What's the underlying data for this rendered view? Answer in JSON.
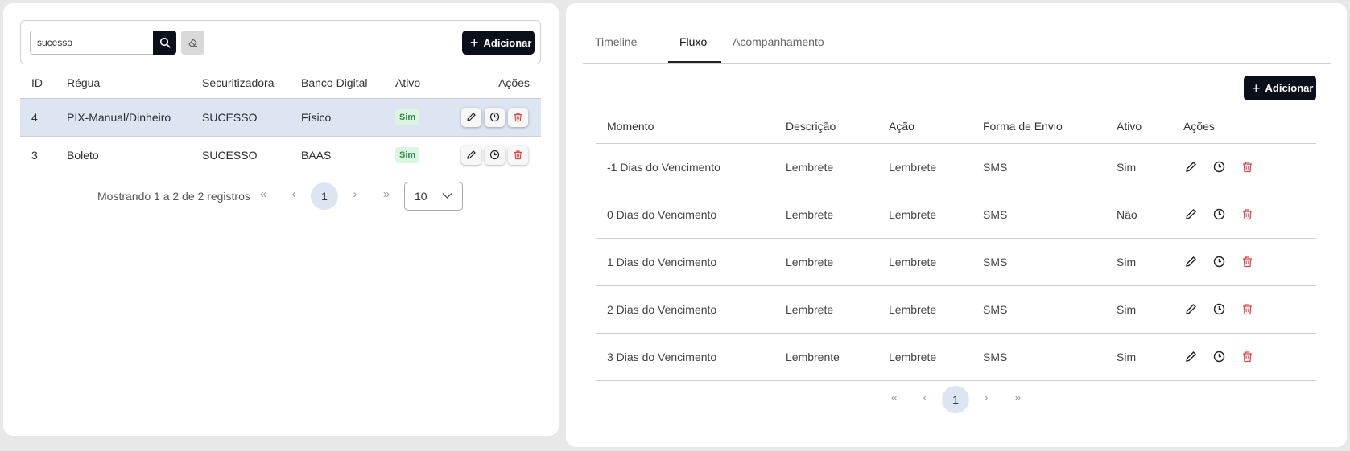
{
  "left": {
    "search": {
      "value": "sucesso",
      "placeholder": ""
    },
    "add_label": "Adicionar",
    "columns": [
      "ID",
      "Régua",
      "Securitizadora",
      "Banco Digital",
      "Ativo",
      "Ações"
    ],
    "rows": [
      {
        "id": "4",
        "regua": "PIX-Manual/Dinheiro",
        "securitizadora": "SUCESSO",
        "banco": "Físico",
        "ativo": "Sim",
        "selected": true
      },
      {
        "id": "3",
        "regua": "Boleto",
        "securitizadora": "SUCESSO",
        "banco": "BAAS",
        "ativo": "Sim",
        "selected": false
      }
    ],
    "pagination": {
      "info": "Mostrando 1 a 2 de 2 registros",
      "first": "«",
      "prev": "‹",
      "page": "1",
      "next": "›",
      "last": "»",
      "page_size": "10"
    }
  },
  "right": {
    "tabs": [
      "Timeline",
      "Fluxo",
      "Acompanhamento"
    ],
    "active_tab": "Fluxo",
    "add_label": "Adicionar",
    "columns": [
      "Momento",
      "Descrição",
      "Ação",
      "Forma de Envio",
      "Ativo",
      "Ações"
    ],
    "rows": [
      {
        "momento": "-1 Dias do Vencimento",
        "descricao": "Lembrete",
        "acao": "Lembrete",
        "forma": "SMS",
        "ativo": "Sim"
      },
      {
        "momento": "0 Dias do Vencimento",
        "descricao": "Lembrete",
        "acao": "Lembrete",
        "forma": "SMS",
        "ativo": "Não"
      },
      {
        "momento": "1 Dias do Vencimento",
        "descricao": "Lembrete",
        "acao": "Lembrete",
        "forma": "SMS",
        "ativo": "Sim"
      },
      {
        "momento": "2 Dias do Vencimento",
        "descricao": "Lembrete",
        "acao": "Lembrete",
        "forma": "SMS",
        "ativo": "Sim"
      },
      {
        "momento": "3 Dias do Vencimento",
        "descricao": "Lembrente",
        "acao": "Lembrete",
        "forma": "SMS",
        "ativo": "Sim"
      }
    ],
    "pagination": {
      "first": "«",
      "prev": "‹",
      "page": "1",
      "next": "›",
      "last": "»"
    }
  },
  "colors": {
    "primary": "#0b0f1a",
    "selected_row": "#dde5f3",
    "badge_bg": "#dcf5e3",
    "badge_text": "#2e8b4a",
    "delete": "#e0454a"
  },
  "icons": [
    "search-icon",
    "eraser-icon",
    "plus-icon",
    "edit-icon",
    "history-icon",
    "trash-icon",
    "chevron-down-icon"
  ]
}
